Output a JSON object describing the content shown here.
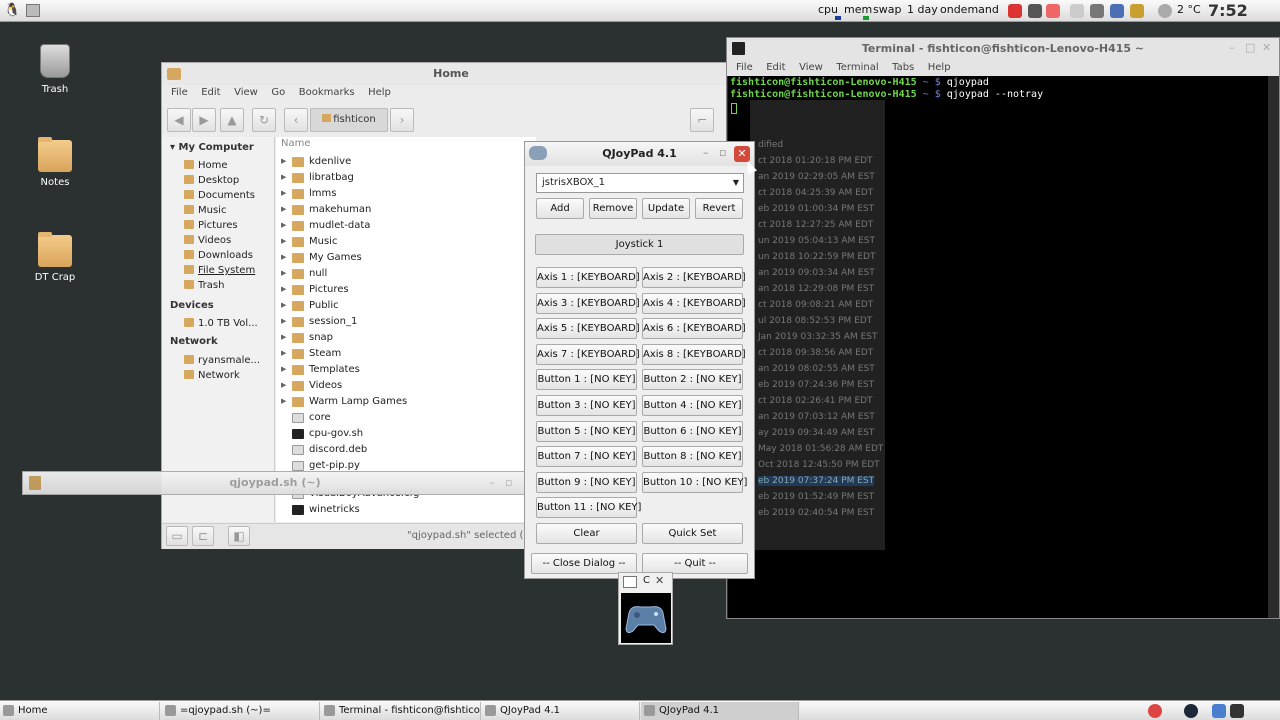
{
  "top_panel": {
    "cpu": "cpu",
    "mem": "mem",
    "swap": "swap",
    "uptime": "1 day",
    "governor": "ondemand",
    "temp": "2 °C",
    "clock": "7:52"
  },
  "desktop": {
    "icons": [
      {
        "label": "Trash"
      },
      {
        "label": "Notes"
      },
      {
        "label": "DT Crap"
      }
    ]
  },
  "file_manager": {
    "title": "Home",
    "menu": [
      "File",
      "Edit",
      "View",
      "Go",
      "Bookmarks",
      "Help"
    ],
    "location": "fishticon",
    "column_name": "Name",
    "sidebar": {
      "my_computer": "My Computer",
      "items": [
        "Home",
        "Desktop",
        "Documents",
        "Music",
        "Pictures",
        "Videos",
        "Downloads",
        "File System",
        "Trash"
      ],
      "devices": "Devices",
      "device_items": [
        "1.0 TB Vol..."
      ],
      "network": "Network",
      "network_items": [
        "ryansmale...",
        "Network"
      ]
    },
    "files": [
      {
        "name": "kdenlive",
        "type": "folder"
      },
      {
        "name": "libratbag",
        "type": "folder"
      },
      {
        "name": "lmms",
        "type": "folder"
      },
      {
        "name": "makehuman",
        "type": "folder"
      },
      {
        "name": "mudlet-data",
        "type": "folder"
      },
      {
        "name": "Music",
        "type": "folder"
      },
      {
        "name": "My Games",
        "type": "folder"
      },
      {
        "name": "null",
        "type": "folder"
      },
      {
        "name": "Pictures",
        "type": "folder"
      },
      {
        "name": "Public",
        "type": "folder"
      },
      {
        "name": "session_1",
        "type": "folder"
      },
      {
        "name": "snap",
        "type": "folder"
      },
      {
        "name": "Steam",
        "type": "folder"
      },
      {
        "name": "Templates",
        "type": "folder"
      },
      {
        "name": "Videos",
        "type": "folder"
      },
      {
        "name": "Warm Lamp Games",
        "type": "folder"
      },
      {
        "name": "core",
        "type": "file"
      },
      {
        "name": "cpu-gov.sh",
        "type": "script"
      },
      {
        "name": "discord.deb",
        "type": "file"
      },
      {
        "name": "get-pip.py",
        "type": "file"
      },
      {
        "name": "VisualBoyAdvance.cfg",
        "type": "file"
      },
      {
        "name": "winetricks",
        "type": "script"
      }
    ],
    "status": "\"qjoypad.sh\" selected (31 b"
  },
  "qjoypad_sh_bar": {
    "title": "qjoypad.sh (~)"
  },
  "terminal": {
    "title": "Terminal - fishticon@fishticon-Lenovo-H415 ~",
    "menu": [
      "File",
      "Edit",
      "View",
      "Terminal",
      "Tabs",
      "Help"
    ],
    "lines": [
      {
        "prompt": "fishticon@fishticon-Lenovo-H415",
        "path": "~ $",
        "cmd": "qjoypad"
      },
      {
        "prompt": "fishticon@fishticon-Lenovo-H415",
        "path": "~ $",
        "cmd": "qjoypad --notray"
      }
    ],
    "ghost_header": "dified",
    "ghost_rows": [
      "ct 2018 01:20:18 PM EDT",
      "an 2019 02:29:05 AM EST",
      "ct 2018 04:25:39 AM EDT",
      "eb 2019 01:00:34 PM EST",
      "ct 2018 12:27:25 AM EDT",
      "un 2019 05:04:13 AM EST",
      "un 2018 10:22:59 PM EDT",
      "an 2019 09:03:34 AM EST",
      "an 2018 12:29:08 PM EST",
      "ct 2018 09:08:21 AM EDT",
      "ul 2018 08:52:53 PM EDT",
      "Jan 2019 03:32:35 AM EST",
      "ct 2018 09:38:56 AM EDT",
      "an 2019 08:02:55 AM EST",
      "eb 2019 07:24:36 PM EST",
      "ct 2018 02:26:41 PM EDT",
      "an 2019 07:03:12 AM EST",
      "ay 2019 09:34:49 AM EST",
      "May 2018 01:56:28 AM EDT",
      "Oct 2018 12:45:50 PM EDT",
      "eb 2019 07:37:24 PM EST",
      "eb 2019 01:52:49 PM EST",
      "eb 2019 02:40:54 PM EST"
    ]
  },
  "qjoypad": {
    "title": "QJoyPad 4.1",
    "layout": "jstrisXBOX_1",
    "add": "Add",
    "remove": "Remove",
    "update": "Update",
    "revert": "Revert",
    "joystick": "Joystick 1",
    "buttons": [
      "Axis 1 : [KEYBOARD]",
      "Axis 2 : [KEYBOARD]",
      "Axis 3 : [KEYBOARD]",
      "Axis 4 : [KEYBOARD]",
      "Axis 5 : [KEYBOARD]",
      "Axis 6 : [KEYBOARD]",
      "Axis 7 : [KEYBOARD]",
      "Axis 8 : [KEYBOARD]",
      "Button 1 : [NO KEY]",
      "Button 2 : [NO KEY]",
      "Button 3 : [NO KEY]",
      "Button 4 : [NO KEY]",
      "Button 5 : [NO KEY]",
      "Button 6 : [NO KEY]",
      "Button 7 : [NO KEY]",
      "Button 8 : [NO KEY]",
      "Button 9 : [NO KEY]",
      "Button 10 : [NO KEY]",
      "Button 11 : [NO KEY]"
    ],
    "clear": "Clear",
    "quick_set": "Quick Set",
    "close_dialog": "-- Close Dialog --",
    "quit": "-- Quit --"
  },
  "tiny_window": {
    "title": "C"
  },
  "taskbar": {
    "items": [
      "Home",
      "=qjoypad.sh (~)=",
      "Terminal - fishticon@fishtico...",
      "QJoyPad 4.1",
      "QJoyPad 4.1"
    ]
  }
}
